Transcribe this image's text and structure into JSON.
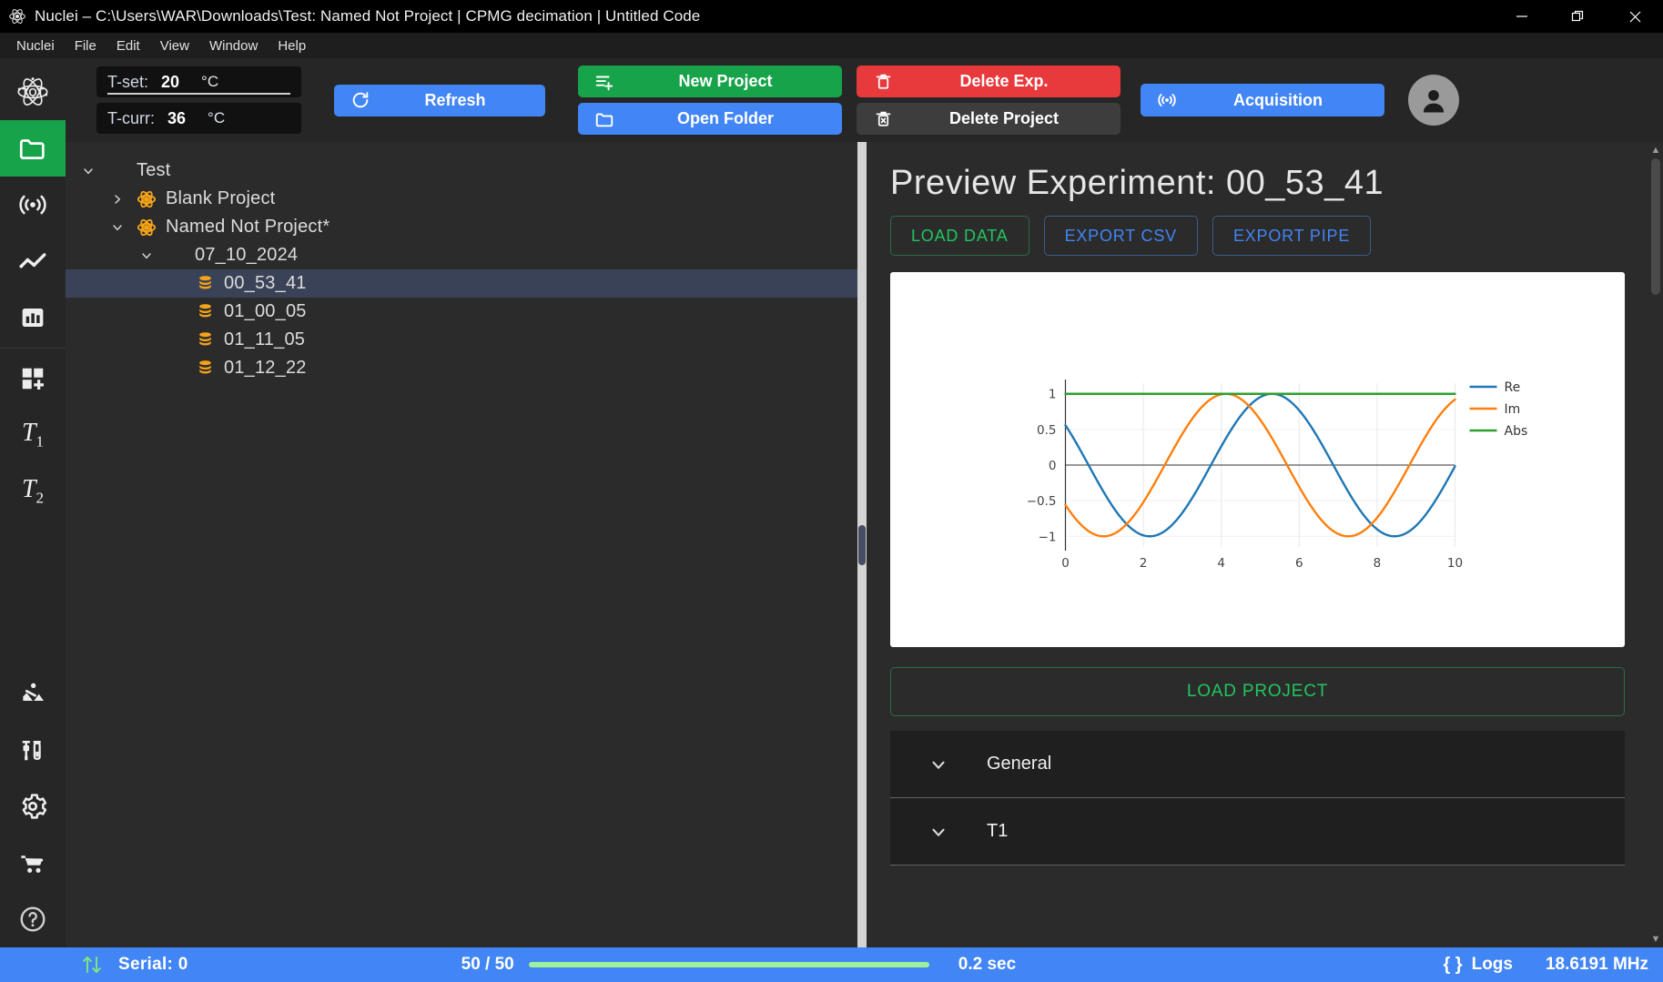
{
  "window": {
    "title": "Nuclei – C:\\Users\\WAR\\Downloads\\Test: Named Not Project | CPMG decimation | Untitled Code",
    "minimize_label": "—",
    "maximize_label": "❐",
    "close_label": "✕"
  },
  "menubar": {
    "items": [
      "Nuclei",
      "File",
      "Edit",
      "View",
      "Window",
      "Help"
    ]
  },
  "rail": {
    "items": [
      {
        "name": "logo",
        "icon": "atom-tqt-icon",
        "label": ""
      },
      {
        "name": "projects",
        "icon": "folder-icon",
        "label": "",
        "active": true
      },
      {
        "name": "acquisition",
        "icon": "broadcast-icon",
        "label": ""
      },
      {
        "name": "signal",
        "icon": "line-chart-icon",
        "label": ""
      },
      {
        "name": "analysis",
        "icon": "bar-chart-icon",
        "label": ""
      },
      {
        "name": "add-module",
        "icon": "grid-plus-icon",
        "label": ""
      },
      {
        "name": "t1",
        "icon": "t1-icon",
        "label": "T1"
      },
      {
        "name": "t2",
        "icon": "t2-icon",
        "label": "T2"
      },
      {
        "name": "maintenance",
        "icon": "construction-icon",
        "label": ""
      },
      {
        "name": "calibration",
        "icon": "syringe-vial-icon",
        "label": ""
      },
      {
        "name": "settings",
        "icon": "gear-icon",
        "label": ""
      },
      {
        "name": "tools",
        "icon": "cart-icon",
        "label": ""
      },
      {
        "name": "help",
        "icon": "question-circle-icon",
        "label": ""
      }
    ]
  },
  "toolbar": {
    "tset": {
      "label": "T-set:",
      "value": "20",
      "unit": "°C"
    },
    "tcurr": {
      "label": "T-curr:",
      "value": "36",
      "unit": "°C"
    },
    "refresh": {
      "label": "Refresh",
      "icon": "refresh-icon"
    },
    "new_project": {
      "label": "New Project",
      "icon": "list-plus-icon"
    },
    "open_folder": {
      "label": "Open Folder",
      "icon": "folder-icon"
    },
    "delete_exp": {
      "label": "Delete Exp.",
      "icon": "trash-icon"
    },
    "delete_project": {
      "label": "Delete Project",
      "icon": "trash-x-icon"
    },
    "acquisition": {
      "label": "Acquisition",
      "icon": "broadcast-icon"
    },
    "avatar": {
      "icon": "user-avatar-icon"
    }
  },
  "tree": {
    "nodes": [
      {
        "label": "Test",
        "depth": 0,
        "chevron": "down",
        "icon": "none"
      },
      {
        "label": "Blank Project",
        "depth": 1,
        "chevron": "right",
        "icon": "atom-icon"
      },
      {
        "label": "Named Not Project*",
        "depth": 1,
        "chevron": "down",
        "icon": "atom-icon"
      },
      {
        "label": "07_10_2024",
        "depth": 2,
        "chevron": "down",
        "icon": "none"
      },
      {
        "label": "00_53_41",
        "depth": 3,
        "chevron": "none",
        "icon": "database-icon",
        "selected": true
      },
      {
        "label": "01_00_05",
        "depth": 3,
        "chevron": "none",
        "icon": "database-icon"
      },
      {
        "label": "01_11_05",
        "depth": 3,
        "chevron": "none",
        "icon": "database-icon"
      },
      {
        "label": "01_12_22",
        "depth": 3,
        "chevron": "none",
        "icon": "database-icon"
      }
    ]
  },
  "preview": {
    "title": "Preview Experiment: 00_53_41",
    "actions": [
      {
        "label": "LOAD DATA",
        "style": "green"
      },
      {
        "label": "EXPORT CSV",
        "style": "blue"
      },
      {
        "label": "EXPORT PIPE",
        "style": "blue"
      }
    ],
    "load_project_label": "LOAD PROJECT",
    "accordion": [
      {
        "label": "General",
        "chevron": "down"
      },
      {
        "label": "T1",
        "chevron": "down"
      }
    ]
  },
  "chart_data": {
    "type": "line",
    "title": "",
    "xlabel": "",
    "ylabel": "",
    "xlim": [
      0,
      10
    ],
    "ylim": [
      -1.15,
      1.15
    ],
    "xticks": [
      0,
      2,
      4,
      6,
      8,
      10
    ],
    "yticks": [
      -1,
      -0.5,
      0,
      0.5,
      1
    ],
    "grid": true,
    "legend_position": "right",
    "series": [
      {
        "name": "Re",
        "color": "#1f77b4",
        "function": "cos",
        "amplitude": 1.0,
        "period": 6.283,
        "phase_deg": 56
      },
      {
        "name": "Im",
        "color": "#ff7f0e",
        "function": "sin",
        "amplitude": 1.0,
        "period": 6.283,
        "phase_deg": -146
      },
      {
        "name": "Abs",
        "color": "#2ca02c",
        "function": "constant",
        "amplitude": 1.0,
        "value": 1.0
      }
    ]
  },
  "statusbar": {
    "transfer_icon": "up-down-arrows-icon",
    "serial": "Serial: 0",
    "count": "50 / 50",
    "time": "0.2 sec",
    "logs_icon": "braces-icon",
    "logs": "Logs",
    "frequency": "18.6191 MHz"
  }
}
